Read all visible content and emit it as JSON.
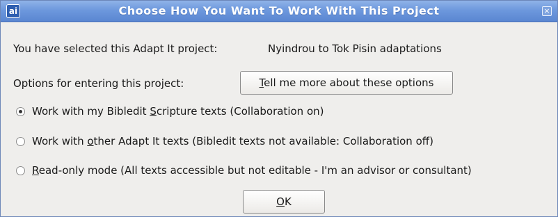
{
  "window": {
    "title": "Choose How You Want To Work With This Project",
    "app_icon_glyph": "ai",
    "close_glyph": "×"
  },
  "project": {
    "label": "You have selected this Adapt It project:",
    "name": "Nyindrou to Tok Pisin adaptations"
  },
  "options": {
    "label": "Options for entering this project:",
    "help_button": {
      "mnemonic": "T",
      "rest": "ell me more about these options"
    },
    "radios": [
      {
        "before": "Work with my Bibledit ",
        "mnemonic": "S",
        "after": "cripture texts (Collaboration on)",
        "checked": true
      },
      {
        "before": "Work with ",
        "mnemonic": "o",
        "after": "ther Adapt It texts (Bibledit texts not available: Collaboration off)",
        "checked": false
      },
      {
        "before": "",
        "mnemonic": "R",
        "after": "ead-only mode (All texts accessible but not editable - I'm an advisor or consultant)",
        "checked": false
      }
    ]
  },
  "ok_button": {
    "mnemonic": "O",
    "rest": "K"
  },
  "colors": {
    "titlebar": "#6d98dd",
    "dialog_bg": "#efeeec"
  }
}
